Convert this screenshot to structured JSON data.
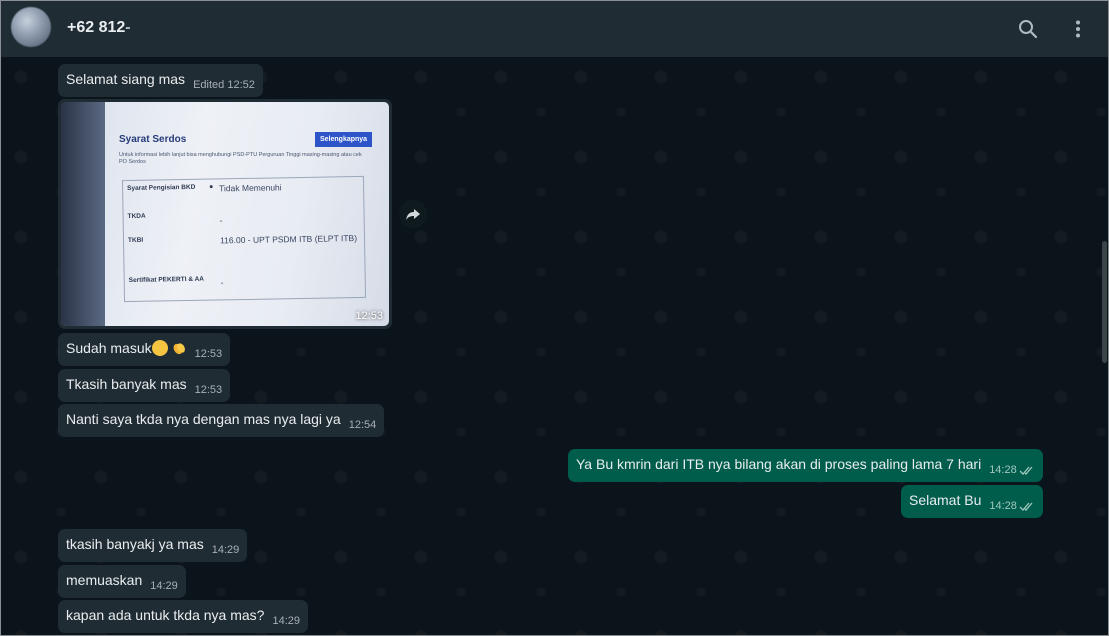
{
  "header": {
    "contact_name": "+62 812-",
    "search_icon": "search-icon",
    "menu_icon": "kebab-menu-icon"
  },
  "messages": {
    "m1": {
      "text": "Selamat siang mas",
      "edited": "Edited",
      "time": "12:52"
    },
    "image": {
      "title": "Syarat Serdos",
      "button": "Selengkapnya",
      "subtitle": "Untuk informasi lebih lanjut bisa menghubungi PSD-PTU Perguruan Tinggi masing-masing atau cek PO Serdos",
      "rows": [
        {
          "label": "Syarat Pengisian BKD",
          "value": "Tidak Memenuhi"
        },
        {
          "label": "TKDA",
          "value": "-"
        },
        {
          "label": "TKBI",
          "value": "116.00 - UPT PSDM ITB (ELPT ITB)"
        },
        {
          "label": "Sertifikat PEKERTI & AA",
          "value": "-"
        }
      ],
      "time": "12:53"
    },
    "m2": {
      "text": "Sudah masuk",
      "emoji1": "grinning-face",
      "emoji2": "clapping-hands",
      "time": "12:53"
    },
    "m3": {
      "text": "Tkasih banyak mas",
      "time": "12:53"
    },
    "m4": {
      "text": "Nanti saya tkda nya dengan mas nya lagi ya",
      "time": "12:54"
    },
    "o1": {
      "text": "Ya Bu kmrin dari ITB nya bilang akan di proses paling lama 7 hari",
      "time": "14:28"
    },
    "o2": {
      "text": "Selamat Bu",
      "time": "14:28"
    },
    "m5": {
      "text": "tkasih banyakj ya mas",
      "time": "14:29"
    },
    "m6": {
      "text": "memuaskan",
      "time": "14:29"
    },
    "m7": {
      "text": "kapan ada untuk tkda nya mas?",
      "time": "14:29"
    }
  },
  "colors": {
    "chat_bg": "#0b141a",
    "incoming": "#202c33",
    "outgoing": "#005c4b",
    "header": "#202c33"
  }
}
